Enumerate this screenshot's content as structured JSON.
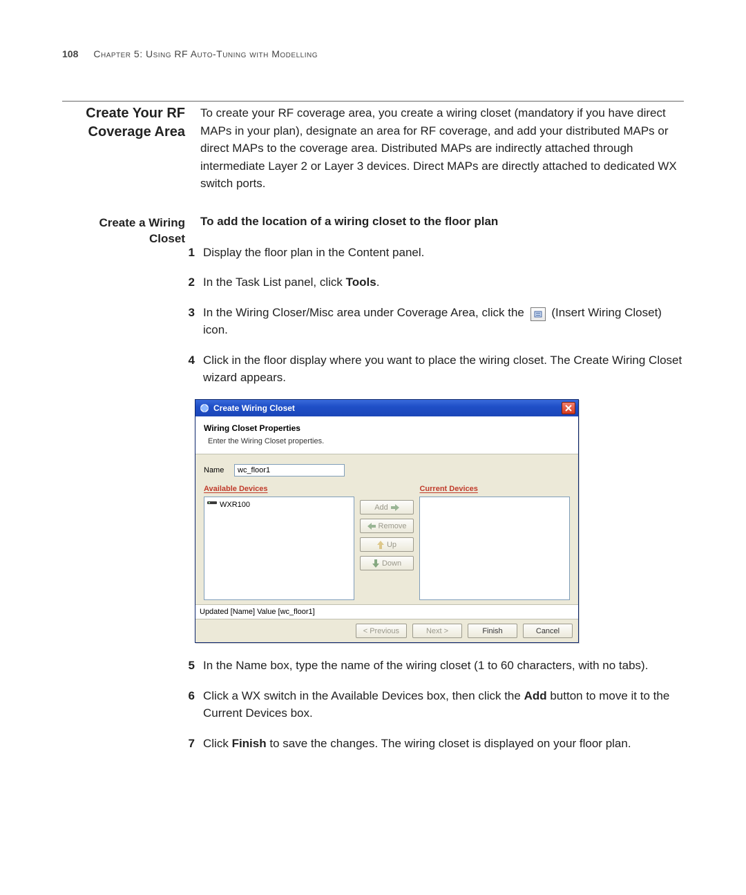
{
  "page": {
    "number": "108",
    "chapter_line": "Chapter 5: Using RF Auto-Tuning with Modelling"
  },
  "section1": {
    "heading": "Create Your RF Coverage Area",
    "body": "To create your RF coverage area, you create a wiring closet (mandatory if you have direct MAPs in your plan), designate an area for RF coverage, and add your distributed MAPs or direct MAPs to the coverage area. Distributed MAPs are indirectly attached through intermediate Layer 2 or Layer 3 devices. Direct MAPs are directly attached to dedicated WX switch ports."
  },
  "section2": {
    "heading": "Create a Wiring Closet",
    "lede": "To add the location of a wiring closet to the floor plan",
    "steps": {
      "s1": "Display the floor plan in the Content panel.",
      "s2_pre": "In the Task List panel, click ",
      "s2_bold": "Tools",
      "s2_post": ".",
      "s3_pre": "In the Wiring Closer/Misc area under Coverage Area, click the ",
      "s3_post": " (Insert Wiring Closet) icon.",
      "s4": "Click in the floor display where you want to place the wiring closet. The Create Wiring Closet wizard appears.",
      "s5": "In the Name box, type the name of the wiring closet (1 to 60 characters, with no tabs).",
      "s6_pre": "Click a WX switch in the Available Devices box, then click the ",
      "s6_bold": "Add",
      "s6_post": " button to move it to the Current Devices box.",
      "s7_pre": "Click ",
      "s7_bold": "Finish",
      "s7_post": " to save the changes. The wiring closet is displayed on your floor plan."
    }
  },
  "dialog": {
    "title": "Create Wiring Closet",
    "header": "Wiring Closet Properties",
    "description": "Enter the Wiring Closet properties.",
    "name_label": "Name",
    "name_value": "wc_floor1",
    "available_label": "Available Devices",
    "available_items": {
      "i0": "WXR100"
    },
    "current_label": "Current Devices",
    "btn_add": "Add",
    "btn_remove": "Remove",
    "btn_up": "Up",
    "btn_down": "Down",
    "status": "Updated [Name] Value [wc_floor1]",
    "btn_prev": "< Previous",
    "btn_next": "Next >",
    "btn_finish": "Finish",
    "btn_cancel": "Cancel"
  }
}
